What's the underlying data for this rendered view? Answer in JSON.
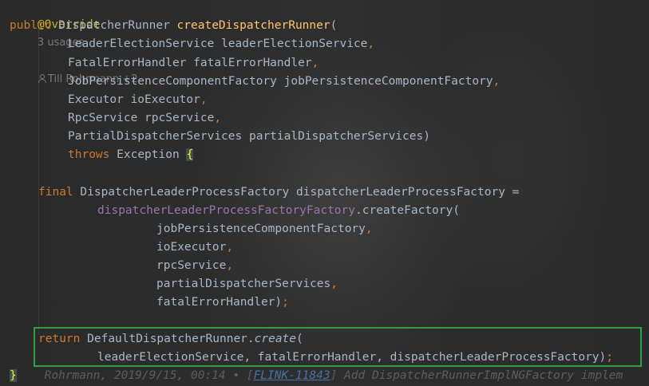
{
  "editor": {
    "header": {
      "annotation": "@Override",
      "usages": "3 usages",
      "authors": "Till Rohrmann +2"
    },
    "tokens": {
      "public": "public",
      "return_type": "DispatcherRunner",
      "method_name": "createDispatcherRunner",
      "open_paren": "(",
      "comma": ",",
      "close_paren": ")",
      "semicolon": ";",
      "throws": "throws",
      "exception": "Exception",
      "open_brace": "{",
      "close_brace": "}",
      "final": "final",
      "factory_type": "DispatcherLeaderProcessFactory",
      "factory_var": "dispatcherLeaderProcessFactory",
      "equals": "=",
      "factory_factory_field": "dispatcherLeaderProcessFactoryFactory",
      "create_factory_call": ".createFactory(",
      "return": "return",
      "runner_class": "DefaultDispatcherRunner.",
      "create_method": "create",
      "create_open": "("
    },
    "params": [
      {
        "type": "LeaderElectionService",
        "name": "leaderElectionService"
      },
      {
        "type": "FatalErrorHandler",
        "name": "fatalErrorHandler"
      },
      {
        "type": "JobPersistenceComponentFactory",
        "name": "jobPersistenceComponentFactory"
      },
      {
        "type": "Executor",
        "name": "ioExecutor"
      },
      {
        "type": "RpcService",
        "name": "rpcService"
      },
      {
        "type": "PartialDispatcherServices",
        "name": "partialDispatcherServices"
      }
    ],
    "factory_args": [
      "jobPersistenceComponentFactory",
      "ioExecutor",
      "rpcService",
      "partialDispatcherServices",
      "fatalErrorHandler"
    ],
    "return_args": "leaderElectionService, fatalErrorHandler, dispatcherLeaderProcessFactory",
    "blame": {
      "text": "Rohrmann, 2019/9/15, 00:14 • [",
      "ticket": "FLINK-11843",
      "message": "] Add DispatcherRunnerImplNGFactory implem"
    },
    "colors": {
      "background": "#2b2b2b",
      "keyword": "#cc7832",
      "annotation": "#bbb529",
      "method": "#ffc66d",
      "field": "#9876aa",
      "text": "#a9b7c6",
      "highlight_box": "#2fa043"
    }
  }
}
